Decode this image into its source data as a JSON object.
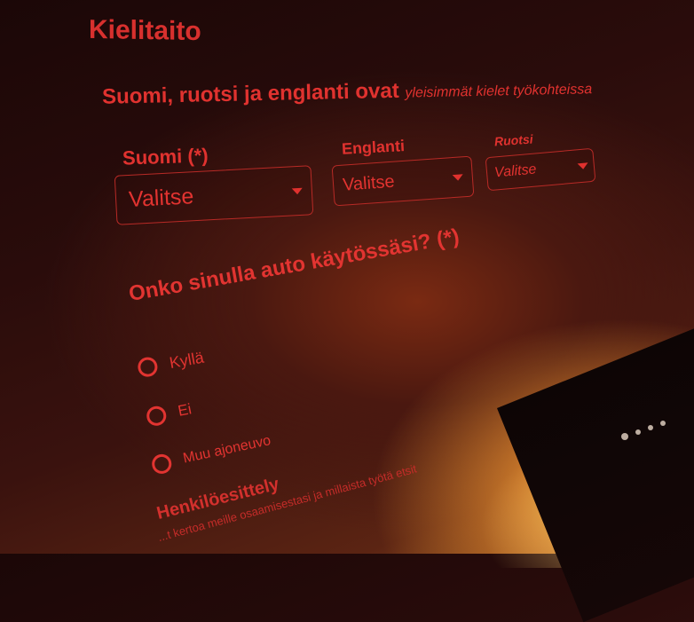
{
  "section": {
    "title": "Kielitaito"
  },
  "subtitle": {
    "main": "Suomi, ruotsi ja englanti ovat",
    "tail": "yleisimmät kielet työkohteissa"
  },
  "languages": [
    {
      "label": "Suomi (*)",
      "value": "Valitse"
    },
    {
      "label": "Englanti",
      "value": "Valitse"
    },
    {
      "label": "Ruotsi",
      "value": "Valitse"
    }
  ],
  "car_question": {
    "label": "Onko sinulla auto käytössäsi? (*)",
    "options": [
      "Kyllä",
      "Ei",
      "Muu ajoneuvo"
    ]
  },
  "intro": {
    "title": "Henkilöesittely",
    "text": "...t kertoa meille osaamisestasi ja millaista työtä etsit"
  },
  "colors": {
    "accent": "#e3322f",
    "background": "#1b0707"
  },
  "icons": {
    "select_caret": "chevron-down-icon",
    "radio": "radio-circle-icon"
  }
}
